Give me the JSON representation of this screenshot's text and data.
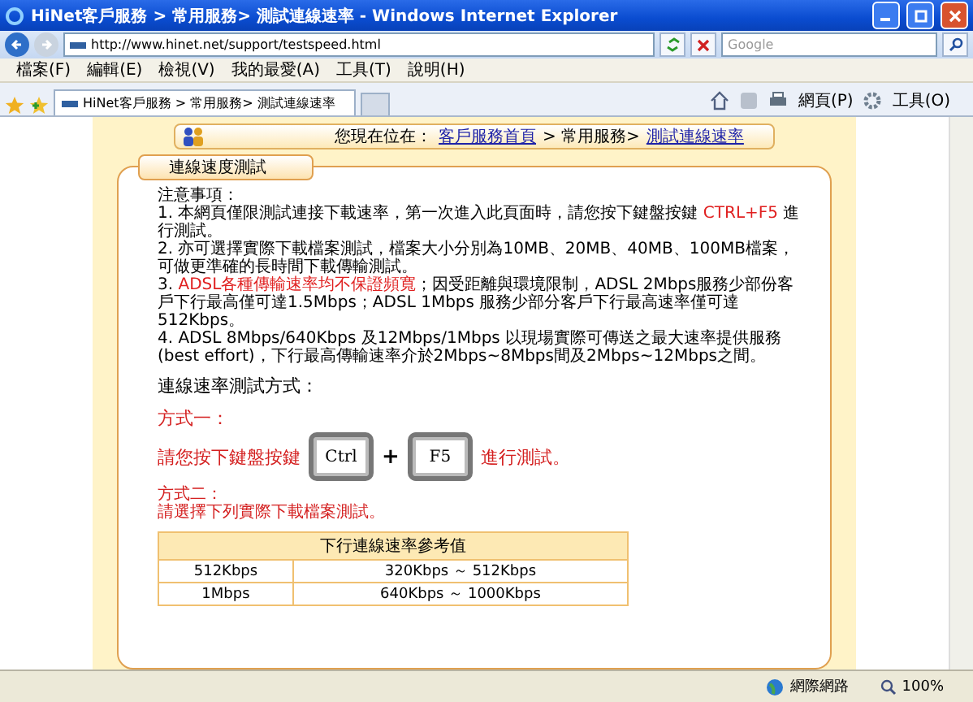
{
  "window": {
    "title": "HiNet客戶服務 > 常用服務> 測試連線速率 - Windows Internet Explorer"
  },
  "address_bar": {
    "url": "http://www.hinet.net/support/testspeed.html",
    "search_placeholder": "Google"
  },
  "menu": [
    "檔案(F)",
    "編輯(E)",
    "檢視(V)",
    "我的最愛(A)",
    "工具(T)",
    "說明(H)"
  ],
  "tabs": [
    {
      "label": "HiNet客戶服務 > 常用服務> 測試連線速率",
      "selected": true
    }
  ],
  "command_bar": {
    "page": "網頁(P)",
    "tools": "工具(O)"
  },
  "breadcrumb": {
    "prefix": "您現在位在：",
    "home_link": "客戶服務首頁",
    "middle": "> 常用服務> ",
    "current_link": "測試連線速率"
  },
  "panel": {
    "title": "連線速度測試",
    "notes_heading": "注意事項：",
    "notes": [
      [
        {
          "text": "1. 本網頁僅限測試連接下載速率，第一次進入此頁面時，請您按下鍵盤按鍵 ",
          "highlight": false
        },
        {
          "text": "CTRL+F5",
          "highlight": true
        },
        {
          "text": " 進行測試。",
          "highlight": false
        }
      ],
      [
        {
          "text": "2. 亦可選擇實際下載檔案測試，檔案大小分別為10MB、20MB、40MB、100MB檔案，可做更準確的長時間下載傳輸測試。",
          "highlight": false
        }
      ],
      [
        {
          "text": "3. ",
          "highlight": false
        },
        {
          "text": "ADSL各種傳輸速率均不保證頻寬",
          "highlight": true
        },
        {
          "text": "；因受距離與環境限制，ADSL 2Mbps服務少部份客戶下行最高僅可達1.5Mbps；ADSL 1Mbps 服務少部分客戶下行最高速率僅可達512Kbps。",
          "highlight": false
        }
      ],
      [
        {
          "text": "4. ADSL 8Mbps/640Kbps 及12Mbps/1Mbps 以現場實際可傳送之最大速率提供服務(best effort)，下行最高傳輸速率介於2Mbps~8Mbps間及2Mbps~12Mbps之間。",
          "highlight": false
        }
      ]
    ],
    "methods_heading": "連線速率測試方式：",
    "method_one": {
      "label": "方式一：",
      "before": "請您按下鍵盤按鍵",
      "keys": [
        "Ctrl",
        "F5"
      ],
      "plus": "+",
      "after": "進行測試。"
    },
    "method_two": {
      "label": "方式二：",
      "text": "請選擇下列實際下載檔案測試。"
    },
    "table": {
      "title": "下行連線速率參考值",
      "rows": [
        [
          "512Kbps",
          "320Kbps ～ 512Kbps"
        ],
        [
          "1Mbps",
          "640Kbps ～ 1000Kbps"
        ]
      ]
    }
  },
  "status_bar": {
    "zone": "網際網路",
    "zoom": "100%"
  }
}
